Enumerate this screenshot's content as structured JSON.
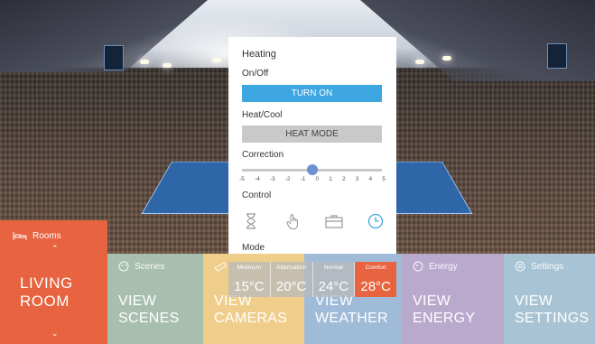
{
  "heating": {
    "title": "Heating",
    "onoff_label": "On/Off",
    "turn_on_button": "TURN ON",
    "heatcool_label": "Heat/Cool",
    "heat_mode_button": "HEAT MODE",
    "correction_label": "Correction",
    "correction_ticks": [
      "-5",
      "-4",
      "-3",
      "-2",
      "-1",
      "0",
      "1",
      "2",
      "3",
      "4",
      "5"
    ],
    "correction_value": 0,
    "control_label": "Control",
    "control_icons": [
      "hourglass-icon",
      "touch-hand-icon",
      "briefcase-icon",
      "clock-icon"
    ],
    "mode_label": "Mode",
    "modes": [
      {
        "name": "Minimum",
        "value": "15°C"
      },
      {
        "name": "Attenuation",
        "value": "20°C"
      },
      {
        "name": "Normal",
        "value": "24°C"
      },
      {
        "name": "Comfort",
        "value": "28°C"
      }
    ],
    "accent": "#3ea6e0"
  },
  "rooms": {
    "head": "Rooms",
    "line1": "LIVING",
    "line2": "ROOM",
    "color": "#e8633f"
  },
  "tiles": {
    "scenes": {
      "head": "Scenes",
      "line1": "VIEW",
      "line2": "SCENES"
    },
    "cameras": {
      "line1": "VIEW",
      "line2": "CAMERAS"
    },
    "weather": {
      "line1": "VIEW",
      "line2": "WEATHER"
    },
    "energy": {
      "head": "Energy",
      "line1": "VIEW",
      "line2": "ENERGY"
    },
    "settings": {
      "head": "Settings",
      "line1": "VIEW",
      "line2": "SETTINGS"
    }
  }
}
